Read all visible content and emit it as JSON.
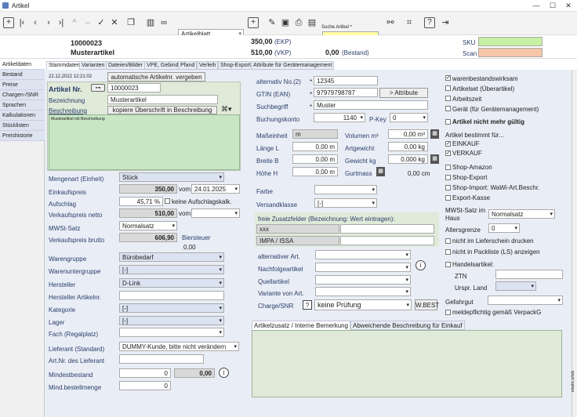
{
  "window": {
    "title": "Artikel"
  },
  "toolbar": {
    "view_select": "Artikelblatt",
    "search_label": "Suche Artikel *"
  },
  "header": {
    "artnr": "10000023",
    "artname": "Musterartikel",
    "ekp_value": "350,00",
    "ekp_label": "(EKP)",
    "vkp_value": "510,00",
    "vkp_label": "(VKP)",
    "bestand_value": "0,00",
    "bestand_label": "(Bestand)",
    "sku_label": "SKU",
    "scan_label": "Scan"
  },
  "sidebar": {
    "items": [
      "Artikeldaten",
      "Bestand",
      "Preise",
      "Chargen-/SNR",
      "Sprachen",
      "Kalkulationen",
      "Stücklisten",
      "Preishistorie"
    ]
  },
  "tabs": [
    "Stammdaten",
    "Varianten",
    "Dateien/Bilder",
    "VPE, Gebinde",
    "Pfand",
    "Verleih",
    "Shop-Export",
    "Attribute für Gerätemanagement"
  ],
  "left": {
    "date": "22.12.2022 12:21:02",
    "auto_btn": "automatische Artikelnr. vergeben",
    "artnr_label": "Artikel Nr.",
    "artnr": "10000023",
    "bez_label": "Bezeichnung",
    "bez": "Musterartikel",
    "besch_label": "Beschreibung",
    "copy_btn": "kopiere Überschrift in Beschreibung",
    "desc_text": "Musterartikel mit Beschreibung",
    "menge_label": "Mengenart (Einheit)",
    "menge": "Stück",
    "ek_label": "Einkaufspreis",
    "ek": "350,00",
    "vom": "vom",
    "ek_date": "24.01.2025",
    "aufschlag_label": "Aufschlag",
    "aufschlag": "45,71 %",
    "keine_aufschlag": "keine Aufschlagskalk.",
    "vkn_label": "Verkaufspreis netto",
    "vkn": "510,00",
    "mwst_label": "MWSt-Satz",
    "mwst": "Normalsatz",
    "vkb_label": "Verkaufspreis brutto",
    "vkb": "606,90",
    "steuer_label": "Biersteuer",
    "steuer": "0,00",
    "wg_label": "Warengruppe",
    "wg": "Bürobedarf",
    "wug_label": "Warenuntergruppe",
    "wug": "[-]",
    "herst_label": "Hersteller",
    "herst": "D-Link",
    "hersta_label": "Hersteller Artikelnr.",
    "kat_label": "Kategorie",
    "kat": "[-]",
    "lager_label": "Lager",
    "lager": "[-]",
    "fach_label": "Fach (Regalplatz)",
    "lief_label": "Lieferant (Standard)",
    "lief": "DUMMY-Kunde, bitte nicht verändern",
    "liefnr_label": "Art.Nr. des Lieferant",
    "minb_label": "Mindestbestand",
    "minb": "0",
    "minb2": "0,00",
    "minm_label": "Mind.bestellmenge",
    "minm": "0"
  },
  "mid": {
    "altnr_label": "alternativ No.(2)",
    "altnr": "12345",
    "gtin_label": "GTIN (EAN)",
    "gtin": "97979798787",
    "attr_btn": "> Attribute",
    "such_label": "Suchbegriff",
    "such": "Muster",
    "buch_label": "Buchungskonto",
    "buch": "1140",
    "pkey_label": "P-Key",
    "pkey": "0",
    "mass_label": "Maßeinheit",
    "mass": "m",
    "vol_label": "Volumen m³",
    "vol": "0,00 m³",
    "laenge_label": "Länge L",
    "laenge": "0,00 m",
    "art_label": "Artgewicht",
    "art": "0,00 kg",
    "breite_label": "Breite B",
    "breite": "0,00 m",
    "gew_label": "Gewicht kg",
    "gew": "0,000 kg",
    "hoehe_label": "Höhe H",
    "hoehe": "0,00 m",
    "gurt_label": "Gurtmass",
    "gurt": "0,00 cm",
    "farbe_label": "Farbe",
    "versand_label": "Versandklasse",
    "versand": "[-]",
    "zusatz_title": "freie Zusatzfelder (Bezeichnung: Wert eintragen):",
    "z1": "xxx",
    "z2": "IMPA / ISSA",
    "altart_label": "alternativer Art.",
    "nachf_label": "Nachfolgeartikel",
    "quell_label": "Quellartikel",
    "var_label": "Variante von Art.",
    "charge_label": "Charge/SNR",
    "charge": "keine Prüfung",
    "wbest": "W.BEST",
    "btab1": "Artikelzusatz / Interne Bemerkung",
    "btab2": "Abweichende Beschreibung für Einkauf"
  },
  "right": {
    "c1": "warenbestandswirksam",
    "c2": "Artikelset (Überartikel)",
    "c3": "Arbeitszeit",
    "c4": "Gerät (für Gerätemanagement)",
    "nicht_gueltig": "Artikel nicht mehr gültig",
    "bestimmt": "Artikel bestimmt für...",
    "einkauf": "EINKAUF",
    "verkauf": "VERKAUF",
    "s1": "Shop-Amazon",
    "s2": "Shop-Export",
    "s3": "Shop-Import: WaWi-Art.Beschr.",
    "s4": "Export-Kasse",
    "mwst_haus_label": "MWSt-Satz im Haus",
    "mwst_haus": "Normalsatz",
    "alter_label": "Altersgrenze",
    "alter": "0",
    "n1": "nicht im Lieferschein drucken",
    "n2": "nicht in Packliste (LS) anzeigen",
    "handels": "Handelsartikel:",
    "ztn_label": "ZTN",
    "urspr_label": "Urspr. Land",
    "gefahr_label": "Gefahrgut",
    "melde": "meldepflichtig gemäß VerpackG",
    "vert": "elastic.pilots"
  }
}
